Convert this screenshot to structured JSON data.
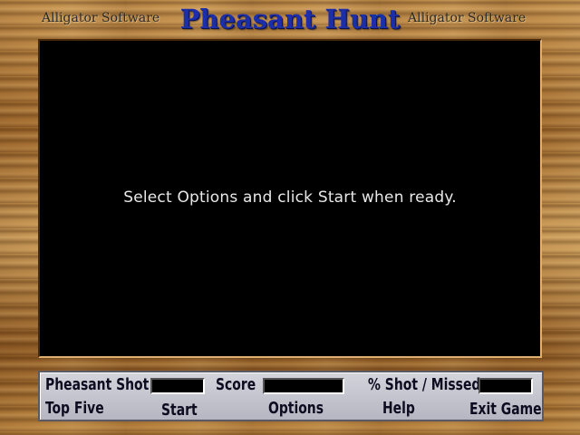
{
  "header": {
    "title": "Pheasant Hunt",
    "brand_left": "Alligator Software",
    "brand_right": "Alligator Software"
  },
  "game_area": {
    "message": "Select Options and click Start when ready."
  },
  "stats": {
    "pheasant_shot_label": "Pheasant Shot",
    "pheasant_shot_value": "",
    "score_label": "Score",
    "score_value": "",
    "shot_missed_label": "% Shot / Missed",
    "shot_missed_value": ""
  },
  "menu": {
    "top_five": "Top Five",
    "start": "Start",
    "options": "Options",
    "help": "Help",
    "exit_game": "Exit Game"
  },
  "colors": {
    "title": "#1c2fa8",
    "game_background": "#000000",
    "panel": "#c6c6d0",
    "wood": "#b98543"
  }
}
